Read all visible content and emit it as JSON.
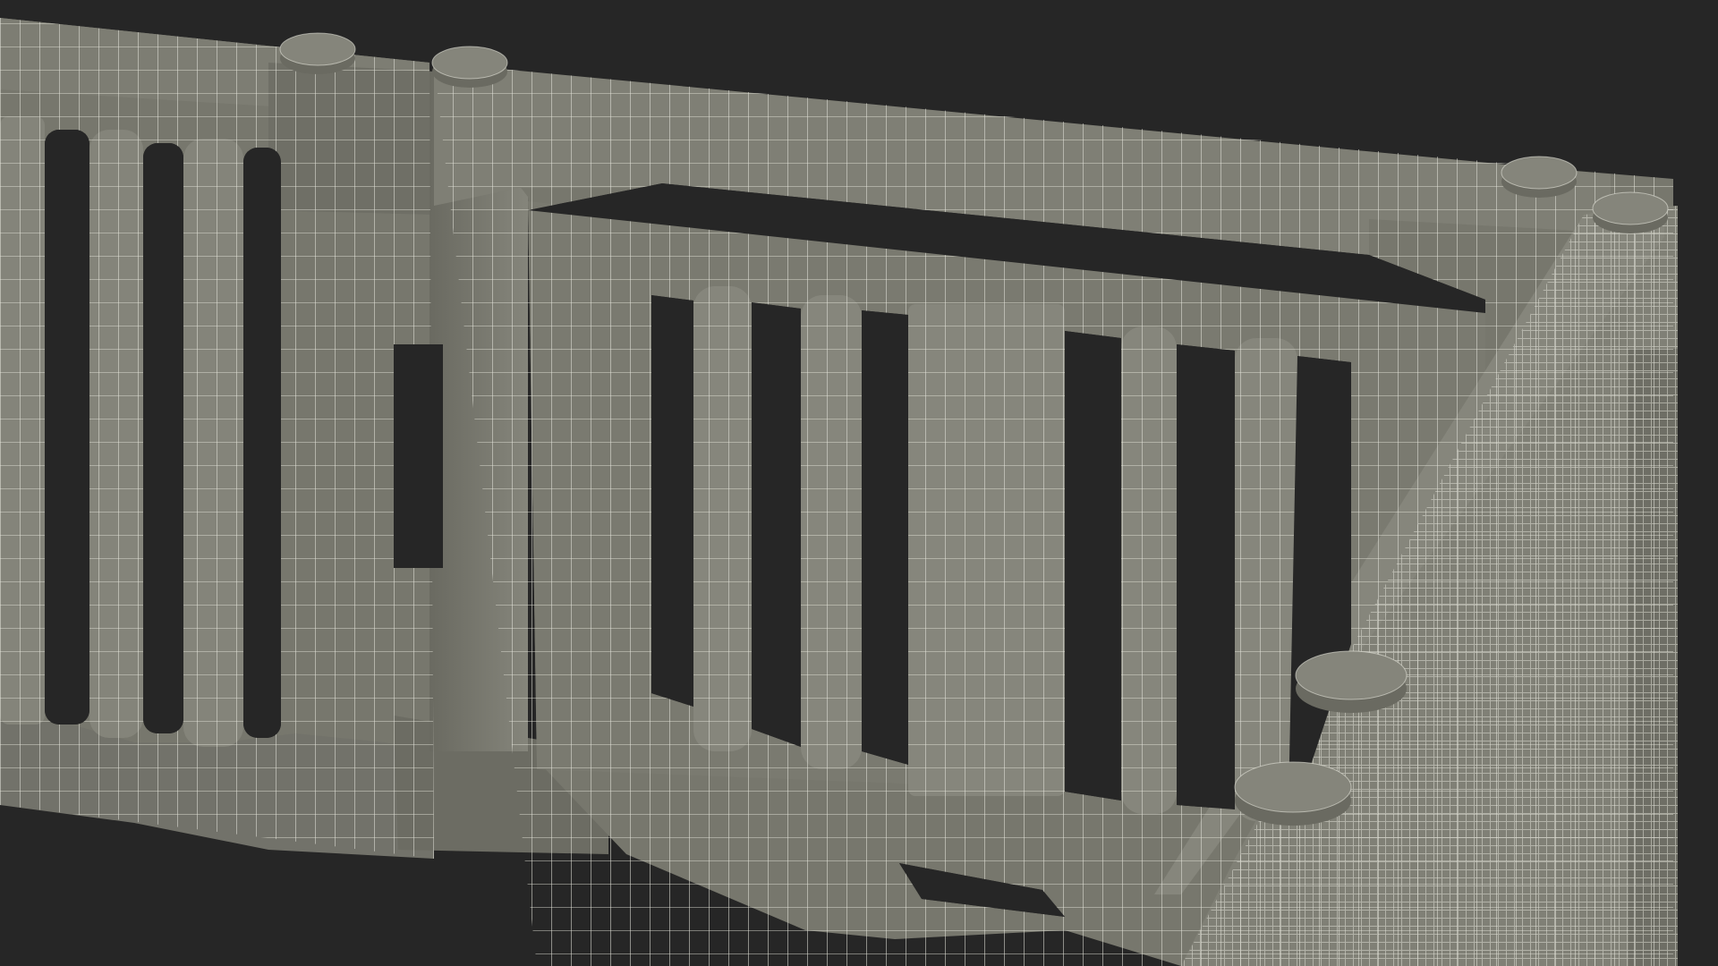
{
  "scene": {
    "subject": "plastic-fence-barrier-wireframe-render",
    "colors": {
      "background": "#262626",
      "surface": "#77776d",
      "surface_light": "#8a8a80",
      "surface_dark": "#5e5e55",
      "gap": "#262626",
      "wire": "#e4e4da"
    }
  }
}
